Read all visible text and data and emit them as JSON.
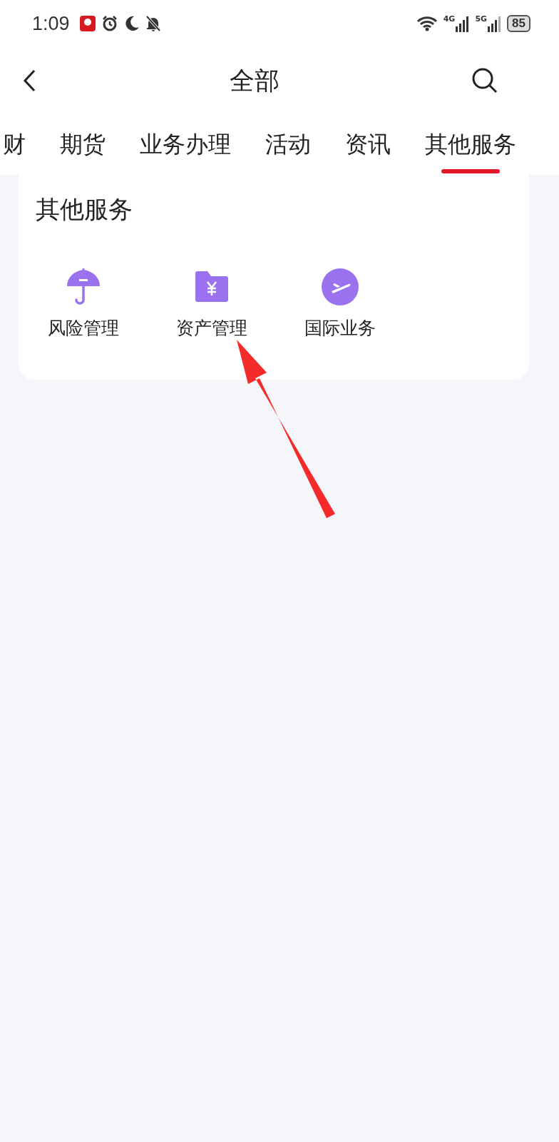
{
  "status_bar": {
    "time": "1:09",
    "network_1": "4G",
    "network_2": "5G",
    "battery": "85"
  },
  "header": {
    "title": "全部"
  },
  "tabs": [
    {
      "label": "财",
      "selected": false
    },
    {
      "label": "期货",
      "selected": false
    },
    {
      "label": "业务办理",
      "selected": false
    },
    {
      "label": "活动",
      "selected": false
    },
    {
      "label": "资讯",
      "selected": false
    },
    {
      "label": "其他服务",
      "selected": true
    }
  ],
  "section": {
    "title": "其他服务",
    "items": [
      {
        "kind": "umbrella",
        "label": "风险管理"
      },
      {
        "kind": "folder",
        "label": "资产管理"
      },
      {
        "kind": "plane",
        "label": "国际业务"
      }
    ]
  }
}
